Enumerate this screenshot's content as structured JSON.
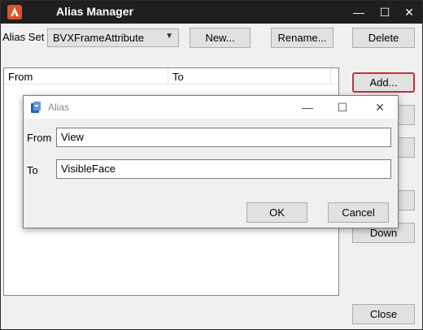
{
  "window": {
    "title": "Alias Manager",
    "minimize_icon": "—",
    "maximize_icon": "☐",
    "close_icon": "✕"
  },
  "alias_set": {
    "label": "Alias Set",
    "selected": "BVXFrameAttribute"
  },
  "buttons": {
    "new": "New...",
    "rename": "Rename...",
    "delete": "Delete",
    "add": "Add...",
    "down": "Down",
    "close": "Close"
  },
  "list": {
    "columns": [
      "From",
      "To"
    ]
  },
  "dialog": {
    "title": "Alias",
    "from_label": "From",
    "from_value": "View",
    "to_label": "To",
    "to_value": "VisibleFace",
    "ok": "OK",
    "cancel": "Cancel",
    "minimize_icon": "—",
    "maximize_icon": "☐",
    "close_icon": "✕"
  },
  "colors": {
    "titlebar": "#1f1f1f",
    "focus_border": "#c0313a",
    "app_icon": "#e0502a"
  }
}
